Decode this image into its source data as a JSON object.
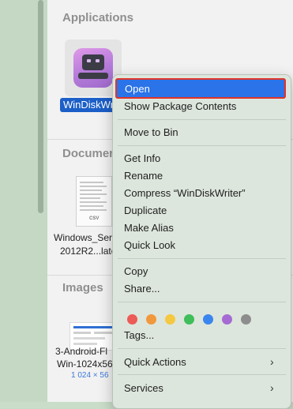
{
  "finder": {
    "sections": {
      "applications": "Applications",
      "documents": "Documer",
      "images": "Images"
    },
    "app_name": "WinDiskWri",
    "doc_name_line1": "Windows_Ser",
    "doc_name_line2": "2012R2...lated",
    "doc_badge": "CSV",
    "image_name_line1": "3-Android-Fl",
    "image_name_line2": "Win-1024x56",
    "image_dimensions": "1 024 × 56"
  },
  "menu": {
    "open": "Open",
    "show_package_contents": "Show Package Contents",
    "move_to_bin": "Move to Bin",
    "get_info": "Get Info",
    "rename": "Rename",
    "compress": "Compress “WinDiskWriter”",
    "duplicate": "Duplicate",
    "make_alias": "Make Alias",
    "quick_look": "Quick Look",
    "copy": "Copy",
    "share": "Share...",
    "tags": "Tags...",
    "quick_actions": "Quick Actions",
    "services": "Services",
    "tag_colors": [
      "#ec5b55",
      "#f1983d",
      "#f5c842",
      "#3fbe5a",
      "#3b86ee",
      "#a66bd2",
      "#8d8d8d"
    ]
  },
  "icons": {
    "submenu_chevron": "›"
  }
}
